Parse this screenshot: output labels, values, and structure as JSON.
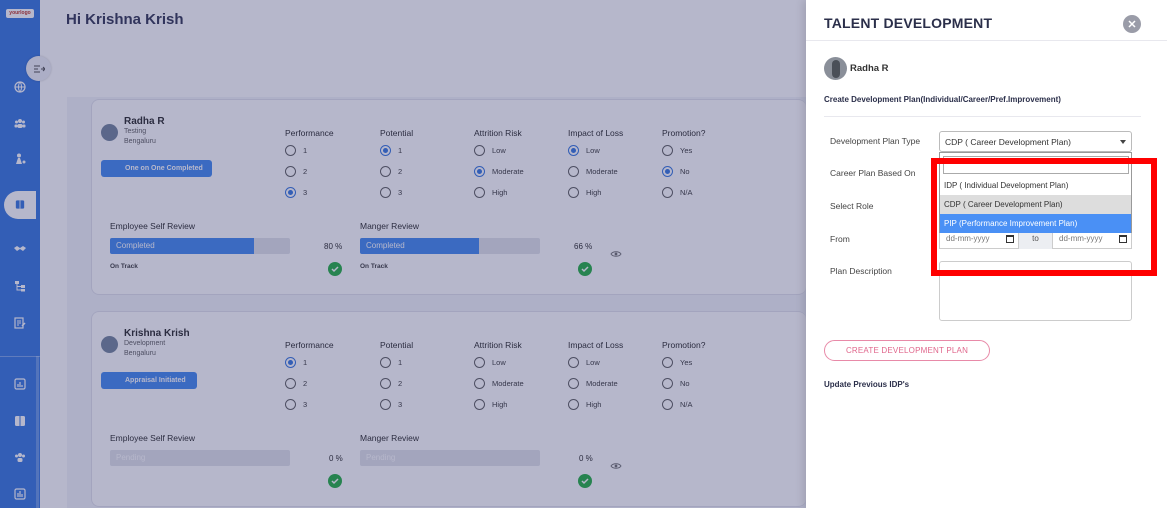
{
  "sidebar": {
    "logo_text": "yourlogo",
    "icons": [
      "globe-icon",
      "team-icon",
      "person-tree-icon",
      "book-icon",
      "handshake-icon",
      "org-chart-icon",
      "edit-doc-icon",
      "report-icon",
      "book-open-icon",
      "group-icon",
      "chart-icon"
    ],
    "accent": "#3e7ce0"
  },
  "main": {
    "greeting": "Hi Krishna Krish",
    "columns": [
      "Performance",
      "Potential",
      "Attrition Risk",
      "Impact of Loss",
      "Promotion?"
    ],
    "performance_options": [
      "1",
      "2",
      "3"
    ],
    "potential_options": [
      "1",
      "2",
      "3"
    ],
    "attrition_options": [
      "Low",
      "Moderate",
      "High"
    ],
    "impact_options": [
      "Low",
      "Moderate",
      "High"
    ],
    "promotion_options": [
      "Yes",
      "No",
      "N/A"
    ],
    "self_review_label": "Employee Self Review",
    "manager_review_label": "Manger Review",
    "employees": [
      {
        "name": "Radha R",
        "dept": "Testing",
        "location": "Bengaluru",
        "status": "One on One Completed",
        "selected": {
          "performance": "3",
          "potential": "1",
          "attrition": "Moderate",
          "impact": "Low",
          "promotion": "No"
        },
        "self_review": {
          "label": "Completed",
          "progress": 0.8,
          "pct_text": "80 %",
          "track": "On Track"
        },
        "manager_review": {
          "label": "Completed",
          "progress": 0.66,
          "pct_text": "66 %",
          "track": "On Track"
        }
      },
      {
        "name": "Krishna Krish",
        "dept": "Development",
        "location": "Bengaluru",
        "status": "Appraisal Initiated",
        "selected": {
          "performance": "1"
        },
        "self_review": {
          "label": "Pending",
          "progress": 0,
          "pct_text": "0 %"
        },
        "manager_review": {
          "label": "Pending",
          "progress": 0,
          "pct_text": "0 %"
        }
      }
    ]
  },
  "drawer": {
    "title": "TALENT DEVELOPMENT",
    "user_name": "Radha R",
    "section_title": "Create Development Plan(Individual/Career/Pref.Improvement)",
    "fields": {
      "plan_type_label": "Development Plan Type",
      "plan_type_value": "CDP ( Career Development Plan)",
      "based_on_label": "Career Plan Based On",
      "role_label": "Select Role",
      "from_label": "From",
      "from_placeholder": "dd-mm-yyyy",
      "to_text": "to",
      "to_placeholder": "dd-mm-yyyy",
      "description_label": "Plan Description"
    },
    "dropdown_options": [
      "IDP ( Individual Development Plan)",
      "CDP ( Career Development Plan)",
      "PIP (Performance Improvement Plan)"
    ],
    "create_button": "CREATE DEVELOPMENT PLAN",
    "update_heading": "Update Previous IDP's"
  }
}
